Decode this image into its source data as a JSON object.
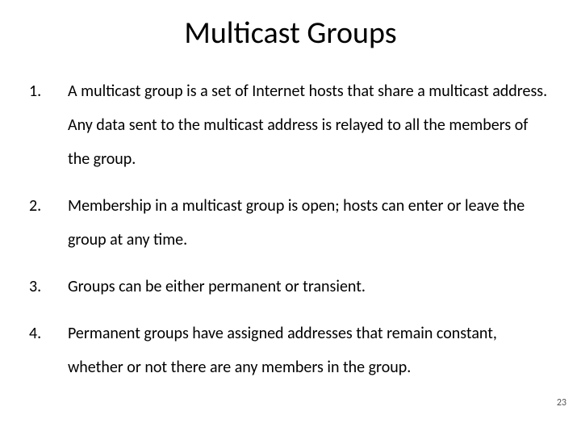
{
  "title": "Multicast Groups",
  "points": [
    "A multicast group is a set of Internet hosts that share a multicast address. Any data sent to the multicast address is relayed to all the members of the group.",
    "Membership in a multicast group is open; hosts can enter or leave the group at any time.",
    "Groups can be either permanent or transient.",
    "Permanent groups have assigned addresses that remain constant, whether or not there are any members in the group."
  ],
  "page_number": "23"
}
